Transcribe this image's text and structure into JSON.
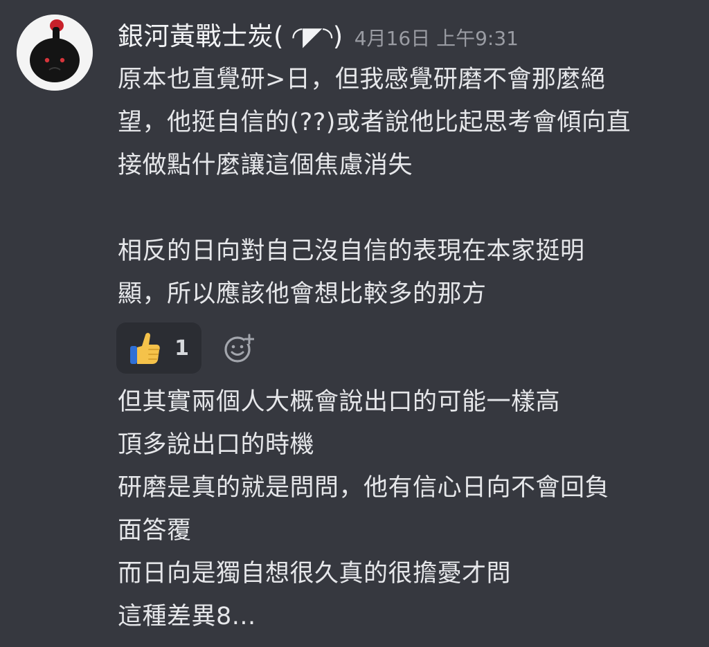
{
  "post": {
    "author": "銀河黃戰士炭( ◜◤◝)",
    "timestamp": "4月16日 上午9:31"
  },
  "message_first": {
    "lines": [
      "原本也直覺研>日，但我感覺研磨不會那麼絕",
      "望，他挺自信的(??)或者說他比起思考會傾向直",
      "接做點什麼讓這個焦慮消失",
      "",
      "相反的日向對自己沒自信的表現在本家挺明",
      "顯，所以應該他會想比較多的那方"
    ]
  },
  "reactions": {
    "items": [
      {
        "icon": "thumbs-up-emoji",
        "count": "1"
      }
    ],
    "add_icon": "add-reaction-icon"
  },
  "message_second": {
    "lines": [
      "但其實兩個人大概會說出口的可能一樣高",
      "頂多說出口的時機",
      "研磨是真的就是問問，他有信心日向不會回負",
      "面答覆",
      "而日向是獨自想很久真的很擔憂才問",
      "這種差異8..."
    ]
  },
  "colors": {
    "background": "#36383f",
    "text": "#e6e7ea",
    "timestamp": "#9a9ca3",
    "reaction_bg": "#2b2d33",
    "thumb": "#f5c24a"
  }
}
